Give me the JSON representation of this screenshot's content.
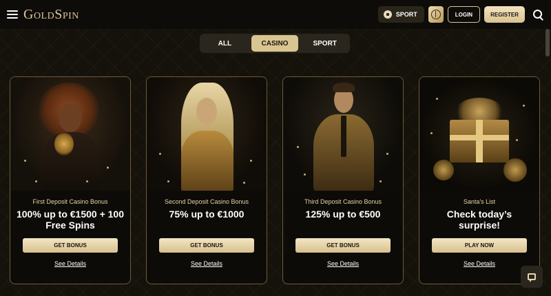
{
  "header": {
    "logo_text": "GoldSpin",
    "sport_label": "SPORT",
    "login_label": "LOGIN",
    "register_label": "REGISTER"
  },
  "tabs": [
    {
      "label": "ALL",
      "active": false
    },
    {
      "label": "CASINO",
      "active": true
    },
    {
      "label": "SPORT",
      "active": false
    }
  ],
  "cards": [
    {
      "subtitle": "First Deposit Casino Bonus",
      "title": "100% up to €1500 + 100 Free Spins",
      "button": "GET BONUS",
      "link": "See Details",
      "image_icon": "woman-curly-hair-illustration"
    },
    {
      "subtitle": "Second Deposit Casino Bonus",
      "title": "75% up to €1000",
      "button": "GET BONUS",
      "link": "See Details",
      "image_icon": "woman-blonde-illustration"
    },
    {
      "subtitle": "Third Deposit Casino Bonus",
      "title": "125% up to €500",
      "button": "GET BONUS",
      "link": "See Details",
      "image_icon": "man-gold-suit-illustration"
    },
    {
      "subtitle": "Santa’s List",
      "title": "Check today’s surprise!",
      "button": "PLAY NOW",
      "link": "See Details",
      "image_icon": "gift-box-illustration"
    }
  ],
  "colors": {
    "accent_gold": "#d8c591",
    "background": "#15120c",
    "card_border": "#6e5c35"
  }
}
